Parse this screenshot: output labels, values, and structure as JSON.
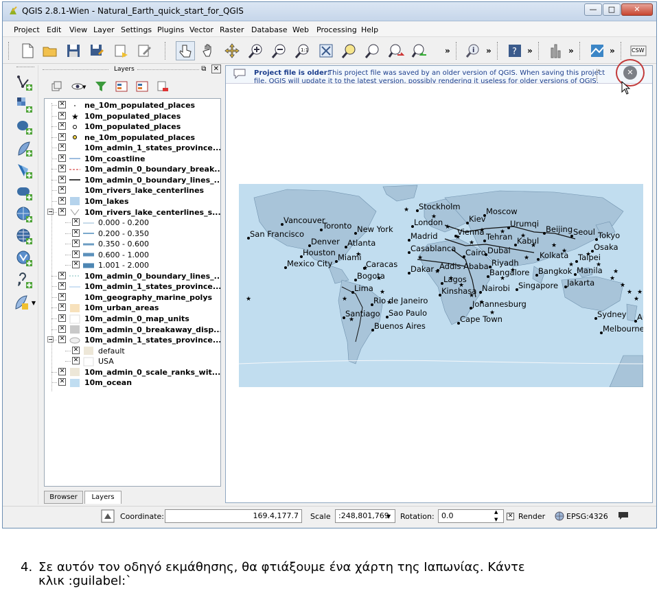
{
  "window": {
    "title": "QGIS 2.8.1-Wien - Natural_Earth_quick_start_for_QGIS",
    "btn_min": "—",
    "btn_max": "□",
    "btn_close": "✕"
  },
  "menu": [
    "Project",
    "Edit",
    "View",
    "Layer",
    "Settings",
    "Plugins",
    "Vector",
    "Raster",
    "Database",
    "Web",
    "Processing",
    "Help"
  ],
  "toolbar": {
    "overflow": "»",
    "csw_label": "CSW"
  },
  "layers_panel": {
    "title": "Layers",
    "float_btn": "⧉",
    "close_btn": "✕",
    "layers": [
      {
        "label": "ne_10m_populated_places",
        "sym": "dot"
      },
      {
        "label": "10m_populated_places",
        "sym": "star"
      },
      {
        "label": "10m_populated_places",
        "sym": "circle"
      },
      {
        "label": "ne_10m_populated_places",
        "sym": "circle-yellow"
      },
      {
        "label": "10m_admin_1_states_province...",
        "sym": "none"
      },
      {
        "label": "10m_coastline",
        "sym": "line-blue"
      },
      {
        "label": "10m_admin_0_boundary_break...",
        "sym": "line-red-dash"
      },
      {
        "label": "10m_admin_0_boundary_lines_...",
        "sym": "line-black"
      },
      {
        "label": "10m_rivers_lake_centerlines",
        "sym": "none"
      },
      {
        "label": "10m_lakes",
        "sym": "fill-lightblue"
      },
      {
        "label": "10m_rivers_lake_centerlines_s...",
        "sym": "graduated"
      },
      {
        "label": "0.000 - 0.200",
        "sym": "grad1"
      },
      {
        "label": "0.200 - 0.350",
        "sym": "grad2"
      },
      {
        "label": "0.350 - 0.600",
        "sym": "grad3"
      },
      {
        "label": "0.600 - 1.000",
        "sym": "grad4"
      },
      {
        "label": "1.001 - 2.000",
        "sym": "grad5"
      },
      {
        "label": "10m_admin_0_boundary_lines_...",
        "sym": "line-dash-lightgreen"
      },
      {
        "label": "10m_admin_1_states_province...",
        "sym": "line-lightblue"
      },
      {
        "label": "10m_geography_marine_polys",
        "sym": "none"
      },
      {
        "label": "10m_urban_areas",
        "sym": "fill-peach"
      },
      {
        "label": "10m_admin_0_map_units",
        "sym": "fill-white"
      },
      {
        "label": "10m_admin_0_breakaway_disp...",
        "sym": "fill-grey"
      },
      {
        "label": "10m_admin_1_states_province...",
        "sym": "categorized"
      },
      {
        "label": "default",
        "sym": "fill-beige"
      },
      {
        "label": "USA",
        "sym": "fill-white"
      },
      {
        "label": "10m_admin_0_scale_ranks_wit...",
        "sym": "fill-beige"
      },
      {
        "label": "10m_ocean",
        "sym": "fill-ocean"
      }
    ],
    "tabs": [
      "Browser",
      "Layers"
    ]
  },
  "message_bar": {
    "title": "Project file is older:",
    "text": "This project file was saved by an older version of QGIS. When saving this project",
    "text2": "file, QGIS will update it to the latest version, possibly rendering it useless for older versions of QGIS.",
    "close_glyph": "✕"
  },
  "map_labels": [
    "Stockholm",
    "Moscow",
    "Vancouver",
    "Toronto",
    "New York",
    "London",
    "Kiev",
    "Urumqi",
    "Beijing",
    "Seoul",
    "Tokyo",
    "San Francisco",
    "Denver",
    "Atlanta",
    "Madrid",
    "Vienna",
    "Tehran",
    "Kabul",
    "Osaka",
    "Houston",
    "Casablanca",
    "Cairo",
    "Dubai",
    "Kolkata",
    "Taipei",
    "Miami",
    "Mexico City",
    "Caracas",
    "Dakar",
    "Addis Ababa",
    "Riyadh",
    "Bangalore",
    "Bangkok",
    "Manila",
    "Bogota",
    "Lagos",
    "Singapore",
    "Jakarta",
    "Lima",
    "Kinshasa",
    "Nairobi",
    "Rio de Janeiro",
    "Johannesburg",
    "Santiago",
    "Sao Paulo",
    "Sydney",
    "Auckland",
    "Cape Town",
    "Buenos Aires",
    "Melbourne"
  ],
  "statusbar": {
    "coordinate_label": "Coordinate:",
    "coordinate_value": "169.4,177.7",
    "scale_label": "Scale",
    "scale_value": ":248,801,769",
    "rotation_label": "Rotation:",
    "rotation_value": "0.0",
    "render_label": "Render",
    "crs_label": "EPSG:4326"
  },
  "caption": {
    "number": "4.",
    "line1": "Σε αυτόν τον οδηγό εκμάθησης, θα φτιάξουμε ένα χάρτη της Ιαπωνίας. Κάντε",
    "line2": "κλικ :guilabel:`"
  }
}
